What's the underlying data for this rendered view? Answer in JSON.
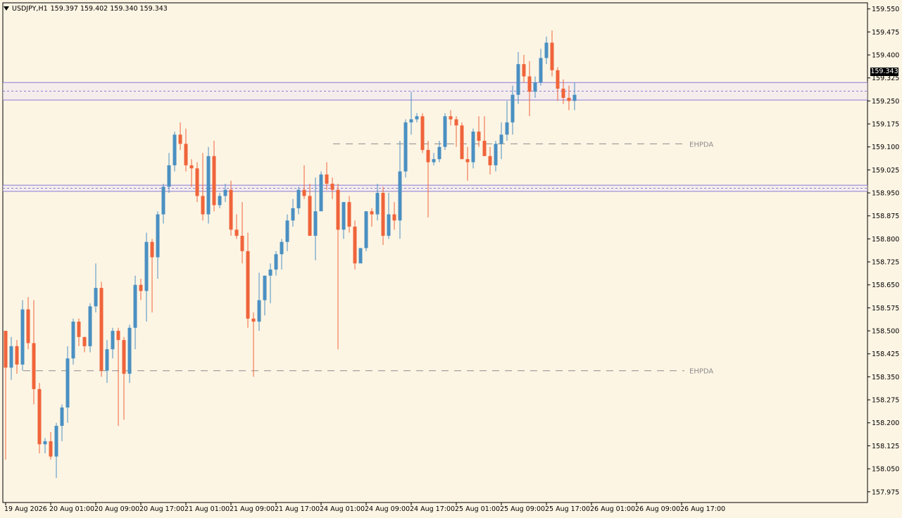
{
  "header": {
    "symbol": "USDJPY,H1",
    "ohlc": "159.397 159.402 159.340 159.343"
  },
  "current_price": "159.343",
  "colors": {
    "background": "#FDF5E4",
    "bull": "#4A90C2",
    "bear": "#F0643A",
    "zone_line": "#8B7BD6",
    "dash_line": "#8C8C8C",
    "price_tag_bg": "#000000"
  },
  "zones": [
    {
      "upper": 159.31,
      "mid": 159.282,
      "lower": 159.253
    },
    {
      "upper": 158.975,
      "mid": 158.965,
      "lower": 158.955
    }
  ],
  "levels": [
    {
      "label": "EHPDA",
      "price": 159.11,
      "from_index": 55
    },
    {
      "label": "EHPDA",
      "price": 158.37,
      "from_index": 0
    }
  ],
  "chart_data": {
    "type": "candlestick",
    "timeframe": "H1",
    "ylim": [
      157.94,
      159.57
    ],
    "y_ticks": [
      "159.550",
      "159.475",
      "159.400",
      "159.325",
      "159.250",
      "159.175",
      "159.100",
      "159.025",
      "158.950",
      "158.875",
      "158.800",
      "158.725",
      "158.650",
      "158.575",
      "158.500",
      "158.425",
      "158.350",
      "158.275",
      "158.200",
      "158.125",
      "158.050",
      "157.975"
    ],
    "x_ticks": [
      {
        "label": "19 Aug 2026",
        "index": 0
      },
      {
        "label": "20 Aug 01:00",
        "index": 8
      },
      {
        "label": "20 Aug 09:00",
        "index": 16
      },
      {
        "label": "20 Aug 17:00",
        "index": 24
      },
      {
        "label": "21 Aug 01:00",
        "index": 32
      },
      {
        "label": "21 Aug 09:00",
        "index": 40
      },
      {
        "label": "21 Aug 17:00",
        "index": 48
      },
      {
        "label": "24 Aug 01:00",
        "index": 56
      },
      {
        "label": "24 Aug 09:00",
        "index": 64
      },
      {
        "label": "24 Aug 17:00",
        "index": 72
      },
      {
        "label": "25 Aug 01:00",
        "index": 80
      },
      {
        "label": "25 Aug 09:00",
        "index": 88
      },
      {
        "label": "25 Aug 17:00",
        "index": 96
      },
      {
        "label": "26 Aug 01:00",
        "index": 104
      },
      {
        "label": "26 Aug 09:00",
        "index": 112
      },
      {
        "label": "26 Aug 17:00",
        "index": 120
      }
    ],
    "candles": [
      [
        158.5,
        158.5,
        158.08,
        158.38
      ],
      [
        158.38,
        158.48,
        158.34,
        158.45
      ],
      [
        158.45,
        158.47,
        158.36,
        158.39
      ],
      [
        158.39,
        158.6,
        158.37,
        158.57
      ],
      [
        158.57,
        158.61,
        158.44,
        158.46
      ],
      [
        158.46,
        158.6,
        158.26,
        158.31
      ],
      [
        158.31,
        158.33,
        158.1,
        158.13
      ],
      [
        158.13,
        158.15,
        158.1,
        158.14
      ],
      [
        158.14,
        158.17,
        158.08,
        158.09
      ],
      [
        158.09,
        158.2,
        158.02,
        158.19
      ],
      [
        158.19,
        158.26,
        158.14,
        158.25
      ],
      [
        158.25,
        158.45,
        158.2,
        158.41
      ],
      [
        158.41,
        158.54,
        158.39,
        158.53
      ],
      [
        158.53,
        158.54,
        158.45,
        158.48
      ],
      [
        158.48,
        158.48,
        158.43,
        158.45
      ],
      [
        158.45,
        158.59,
        158.43,
        158.58
      ],
      [
        158.58,
        158.72,
        158.56,
        158.64
      ],
      [
        158.64,
        158.66,
        158.35,
        158.37
      ],
      [
        158.37,
        158.47,
        158.33,
        158.44
      ],
      [
        158.44,
        158.51,
        158.41,
        158.5
      ],
      [
        158.5,
        158.51,
        158.19,
        158.47
      ],
      [
        158.47,
        158.48,
        158.21,
        158.36
      ],
      [
        158.36,
        158.52,
        158.33,
        158.51
      ],
      [
        158.51,
        158.68,
        158.44,
        158.65
      ],
      [
        158.65,
        158.67,
        158.6,
        158.63
      ],
      [
        158.63,
        158.82,
        158.53,
        158.79
      ],
      [
        158.79,
        158.8,
        158.56,
        158.74
      ],
      [
        158.74,
        158.89,
        158.67,
        158.88
      ],
      [
        158.88,
        158.98,
        158.85,
        158.97
      ],
      [
        158.97,
        159.08,
        158.95,
        159.04
      ],
      [
        159.04,
        159.15,
        159.02,
        159.14
      ],
      [
        159.14,
        159.18,
        159.09,
        159.11
      ],
      [
        159.11,
        159.16,
        159.02,
        159.04
      ],
      [
        159.04,
        159.06,
        158.97,
        159.03
      ],
      [
        159.03,
        159.05,
        158.92,
        158.94
      ],
      [
        158.94,
        159.08,
        158.86,
        158.88
      ],
      [
        158.88,
        159.1,
        158.85,
        159.07
      ],
      [
        159.07,
        159.12,
        158.89,
        158.91
      ],
      [
        158.91,
        158.95,
        158.9,
        158.94
      ],
      [
        158.94,
        158.98,
        158.92,
        158.96
      ],
      [
        158.96,
        158.99,
        158.81,
        158.83
      ],
      [
        158.83,
        158.88,
        158.8,
        158.81
      ],
      [
        158.81,
        158.92,
        158.72,
        158.76
      ],
      [
        158.76,
        158.82,
        158.51,
        158.54
      ],
      [
        158.54,
        158.56,
        158.35,
        158.53
      ],
      [
        158.53,
        158.69,
        158.5,
        158.6
      ],
      [
        158.6,
        158.68,
        158.55,
        158.68
      ],
      [
        158.68,
        158.72,
        158.59,
        158.7
      ],
      [
        158.7,
        158.76,
        158.68,
        158.75
      ],
      [
        158.75,
        158.8,
        158.7,
        158.79
      ],
      [
        158.79,
        158.88,
        158.76,
        158.86
      ],
      [
        158.86,
        158.93,
        158.84,
        158.9
      ],
      [
        158.9,
        158.97,
        158.88,
        158.96
      ],
      [
        158.96,
        159.04,
        158.93,
        158.94
      ],
      [
        158.94,
        158.98,
        158.81,
        158.81
      ],
      [
        158.81,
        159.0,
        158.73,
        158.89
      ],
      [
        158.89,
        159.02,
        158.9,
        159.01
      ],
      [
        159.01,
        159.05,
        158.96,
        158.98
      ],
      [
        158.98,
        159.0,
        158.93,
        158.96
      ],
      [
        158.96,
        158.98,
        158.44,
        158.83
      ],
      [
        158.83,
        158.92,
        158.8,
        158.92
      ],
      [
        158.92,
        158.94,
        158.82,
        158.84
      ],
      [
        158.84,
        158.86,
        158.7,
        158.72
      ],
      [
        158.72,
        158.77,
        158.73,
        158.77
      ],
      [
        158.77,
        158.89,
        158.76,
        158.89
      ],
      [
        158.89,
        158.9,
        158.84,
        158.88
      ],
      [
        158.88,
        158.98,
        158.86,
        158.95
      ],
      [
        158.95,
        158.97,
        158.78,
        158.81
      ],
      [
        158.81,
        158.95,
        158.8,
        158.88
      ],
      [
        158.88,
        158.92,
        158.83,
        158.86
      ],
      [
        158.86,
        159.12,
        158.8,
        159.02
      ],
      [
        159.02,
        159.19,
        159.0,
        159.18
      ],
      [
        159.18,
        159.28,
        159.14,
        159.19
      ],
      [
        159.19,
        159.21,
        159.18,
        159.2
      ],
      [
        159.2,
        159.21,
        159.08,
        159.09
      ],
      [
        159.09,
        159.12,
        158.87,
        159.05
      ],
      [
        159.05,
        159.08,
        159.04,
        159.06
      ],
      [
        159.06,
        159.12,
        159.05,
        159.1
      ],
      [
        159.1,
        159.21,
        159.09,
        159.2
      ],
      [
        159.2,
        159.22,
        159.17,
        159.19
      ],
      [
        159.19,
        159.2,
        159.1,
        159.17
      ],
      [
        159.17,
        159.18,
        159.06,
        159.06
      ],
      [
        159.06,
        159.1,
        158.99,
        159.05
      ],
      [
        159.05,
        159.16,
        159.03,
        159.15
      ],
      [
        159.15,
        159.2,
        159.1,
        159.12
      ],
      [
        159.12,
        159.2,
        159.09,
        159.07
      ],
      [
        159.07,
        159.1,
        159.01,
        159.04
      ],
      [
        159.04,
        159.12,
        159.02,
        159.11
      ],
      [
        159.11,
        159.18,
        159.06,
        159.14
      ],
      [
        159.14,
        159.25,
        159.12,
        159.18
      ],
      [
        159.18,
        159.3,
        159.14,
        159.27
      ],
      [
        159.27,
        159.41,
        159.24,
        159.37
      ],
      [
        159.37,
        159.4,
        159.31,
        159.33
      ],
      [
        159.33,
        159.38,
        159.2,
        159.28
      ],
      [
        159.28,
        159.33,
        159.26,
        159.31
      ],
      [
        159.31,
        159.42,
        159.3,
        159.39
      ],
      [
        159.39,
        159.46,
        159.37,
        159.44
      ],
      [
        159.44,
        159.48,
        159.33,
        159.35
      ],
      [
        159.35,
        159.36,
        159.25,
        159.29
      ],
      [
        159.29,
        159.32,
        159.24,
        159.26
      ],
      [
        159.26,
        159.3,
        159.22,
        159.25
      ],
      [
        159.25,
        159.31,
        159.22,
        159.27
      ]
    ]
  }
}
